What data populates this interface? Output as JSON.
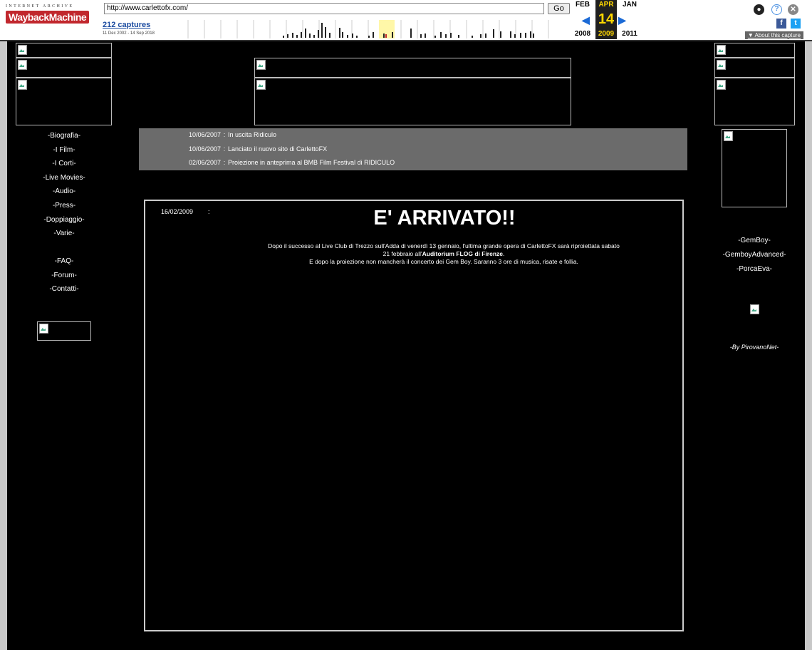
{
  "wayback": {
    "logo_top": "INTERNET ARCHIVE",
    "logo_main": "WaybackMachine",
    "url": "http://www.carlettofx.com/",
    "go_label": "Go",
    "captures": "212 captures",
    "range": "11 Dec 2002 - 14 Sep 2018",
    "prev_month": "FEB",
    "cur_month": "APR",
    "next_month": "JAN",
    "cur_day": "14",
    "prev_year": "2008",
    "cur_year": "2009",
    "next_year": "2011",
    "about": "About this capture",
    "icons": [
      "user-icon",
      "help-icon",
      "close-icon",
      "facebook-icon",
      "twitter-icon"
    ]
  },
  "left_nav": {
    "main": [
      "-Biografia-",
      "-I Film-",
      "-I Corti-",
      "-Live Movies-",
      "-Audio-",
      "-Press-",
      "-Doppiaggio-",
      "-Varie-"
    ],
    "secondary": [
      "-FAQ-",
      "-Forum-",
      "-Contatti-"
    ]
  },
  "news": [
    {
      "date": "10/06/2007",
      "sep": ":",
      "text": "In uscita Ridiculo"
    },
    {
      "date": "10/06/2007",
      "sep": ":",
      "text": "Lanciato il nuovo sito di CarlettoFX"
    },
    {
      "date": "02/06/2007",
      "sep": ":",
      "text": "Proiezione in anteprima al BMB Film Festival di RIDICULO"
    }
  ],
  "article": {
    "date": "16/02/2009",
    "colon": ":",
    "title": "E' ARRIVATO!!",
    "line1": "Dopo il successo al Live Club di Trezzo sull'Adda di venerdì 13 gennaio, l'ultima grande opera di CarlettoFX sarà riproiettata sabato",
    "line2_pre": "21 febbraio all'",
    "line2_bold": "Auditorium FLOG di Firenze",
    "line2_post": ".",
    "line3": "E dopo la proiezione non mancherà il concerto dei Gem Boy. Saranno 3 ore di musica, risate e follia."
  },
  "right_nav": [
    "-GemBoy-",
    "-GemboyAdvanced-",
    "-PorcaEva-"
  ],
  "credit": "-By PirovanoNet-"
}
